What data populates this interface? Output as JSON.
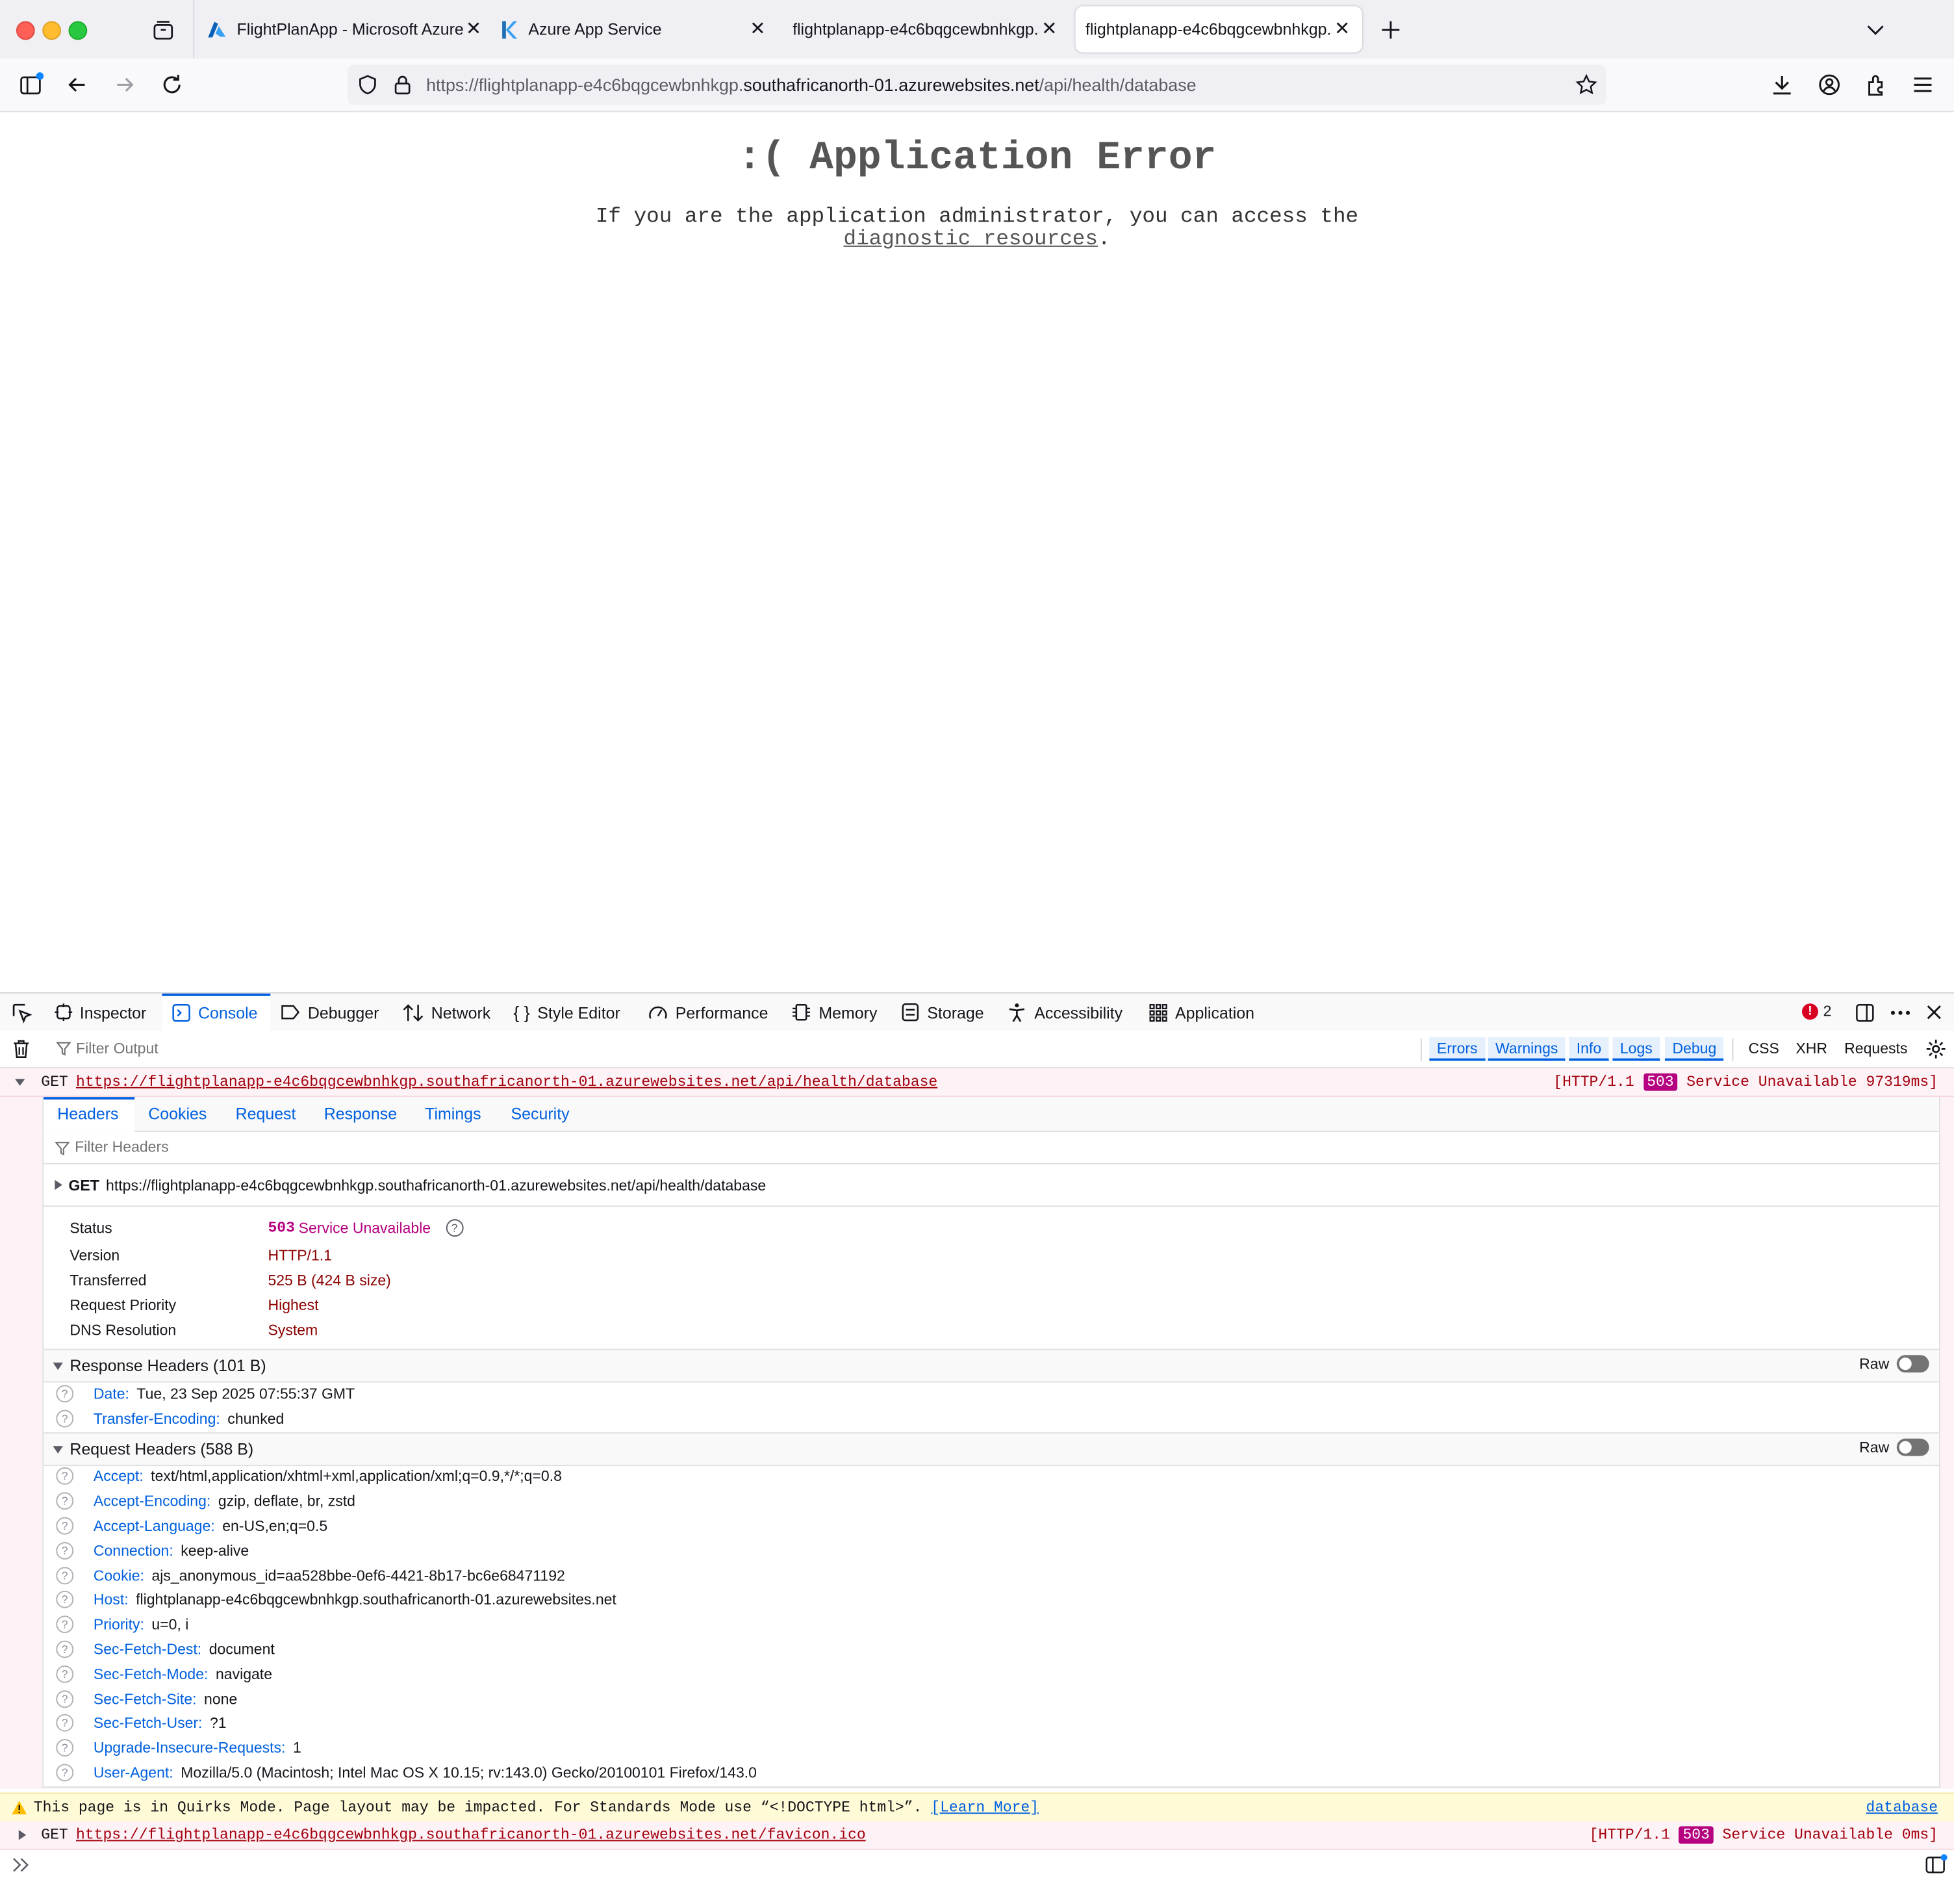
{
  "tabs": [
    {
      "title": "FlightPlanApp - Microsoft Azure",
      "icon": "azure-icon"
    },
    {
      "title": "Azure App Service",
      "icon": "kudu-icon"
    },
    {
      "title": "flightplanapp-e4c6bqgcewbnhkgp.s",
      "icon": ""
    },
    {
      "title": "flightplanapp-e4c6bqgcewbnhkgp.s",
      "icon": ""
    }
  ],
  "urlbar": {
    "prefix": "https://flightplanapp-e4c6bqgcewbnhkgp.",
    "domain": "southafricanorth-01.azurewebsites.net",
    "path": "/api/health/database"
  },
  "page": {
    "title": ":( Application Error",
    "message_pre": "If you are the application administrator, you can access the",
    "link": "diagnostic resources",
    "message_post": "."
  },
  "devtools": {
    "tabs": [
      "Inspector",
      "Console",
      "Debugger",
      "Network",
      "Style Editor",
      "Performance",
      "Memory",
      "Storage",
      "Accessibility",
      "Application"
    ],
    "error_count": "2",
    "filter_placeholder": "Filter Output",
    "filters": [
      "Errors",
      "Warnings",
      "Info",
      "Logs",
      "Debug",
      "CSS",
      "XHR",
      "Requests"
    ]
  },
  "messages": {
    "req1": {
      "method": "GET",
      "url": "https://flightplanapp-e4c6bqgcewbnhkgp.southafricanorth-01.azurewebsites.net/api/health/database",
      "status_pre": "[HTTP/1.1",
      "code": "503",
      "status_post": "Service Unavailable 97319ms]"
    },
    "req2": {
      "method": "GET",
      "url": "https://flightplanapp-e4c6bqgcewbnhkgp.southafricanorth-01.azurewebsites.net/favicon.ico",
      "status_pre": "[HTTP/1.1",
      "code": "503",
      "status_post": "Service Unavailable 0ms]"
    },
    "warning": {
      "text": "This page is in Quirks Mode. Page layout may be impacted. For Standards Mode use “<!DOCTYPE html>”.",
      "link": "[Learn More]",
      "source": "database"
    }
  },
  "netpanel": {
    "tabs": [
      "Headers",
      "Cookies",
      "Request",
      "Response",
      "Timings",
      "Security"
    ],
    "filter_placeholder": "Filter Headers",
    "request_line": {
      "method": "GET",
      "url": "https://flightplanapp-e4c6bqgcewbnhkgp.southafricanorth-01.azurewebsites.net/api/health/database"
    },
    "summary": {
      "status_label": "Status",
      "status_code": "503",
      "status_text": "Service Unavailable",
      "version_label": "Version",
      "version": "HTTP/1.1",
      "transferred_label": "Transferred",
      "transferred": "525 B (424 B size)",
      "priority_label": "Request Priority",
      "priority": "Highest",
      "dns_label": "DNS Resolution",
      "dns": "System"
    },
    "raw_label": "Raw",
    "response_headers_title": "Response Headers (101 B)",
    "response_headers": [
      {
        "k": "Date:",
        "v": "Tue, 23 Sep 2025 07:55:37 GMT"
      },
      {
        "k": "Transfer-Encoding:",
        "v": "chunked"
      }
    ],
    "request_headers_title": "Request Headers (588 B)",
    "request_headers": [
      {
        "k": "Accept:",
        "v": "text/html,application/xhtml+xml,application/xml;q=0.9,*/*;q=0.8"
      },
      {
        "k": "Accept-Encoding:",
        "v": "gzip, deflate, br, zstd"
      },
      {
        "k": "Accept-Language:",
        "v": "en-US,en;q=0.5"
      },
      {
        "k": "Connection:",
        "v": "keep-alive"
      },
      {
        "k": "Cookie:",
        "v": "ajs_anonymous_id=aa528bbe-0ef6-4421-8b17-bc6e68471192"
      },
      {
        "k": "Host:",
        "v": "flightplanapp-e4c6bqgcewbnhkgp.southafricanorth-01.azurewebsites.net"
      },
      {
        "k": "Priority:",
        "v": "u=0, i"
      },
      {
        "k": "Sec-Fetch-Dest:",
        "v": "document"
      },
      {
        "k": "Sec-Fetch-Mode:",
        "v": "navigate"
      },
      {
        "k": "Sec-Fetch-Site:",
        "v": "none"
      },
      {
        "k": "Sec-Fetch-User:",
        "v": "?1"
      },
      {
        "k": "Upgrade-Insecure-Requests:",
        "v": "1"
      },
      {
        "k": "User-Agent:",
        "v": "Mozilla/5.0 (Macintosh; Intel Mac OS X 10.15; rv:143.0) Gecko/20100101 Firefox/143.0"
      }
    ]
  },
  "colors": {
    "accent": "#0060df",
    "error": "#a4000f",
    "status_badge": "#b5007f",
    "warning_bg": "#fffbd6"
  }
}
